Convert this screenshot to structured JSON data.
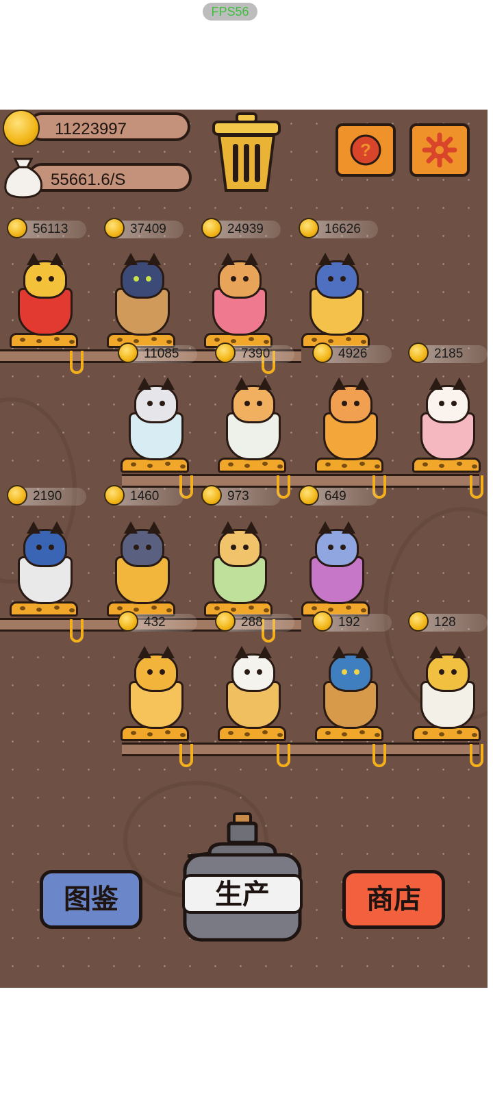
{
  "status": {
    "fps": "FPS56"
  },
  "header": {
    "coins": "11223997",
    "rate": "55661.6/S"
  },
  "icons": {
    "coin": "coin-icon",
    "sack": "money-bag-icon",
    "trash": "trash-can-icon",
    "help": "question-icon",
    "settings": "gear-icon"
  },
  "rows": [
    {
      "prices": [
        "56113",
        "37409",
        "24939",
        "16626"
      ]
    },
    {
      "prices": [
        "11085",
        "7390",
        "4926",
        "2185"
      ]
    },
    {
      "prices": [
        "2190",
        "1460",
        "973",
        "649"
      ]
    },
    {
      "prices": [
        "432",
        "288",
        "192",
        "128"
      ]
    }
  ],
  "buttons": {
    "collection": "图鉴",
    "produce": "生产",
    "shop": "商店"
  },
  "colors": {
    "board": "#6e5144",
    "collection_button": "#6b86c9",
    "shop_button": "#f2603d",
    "coin": "#f2b618",
    "icon_button": "#f0922a"
  }
}
